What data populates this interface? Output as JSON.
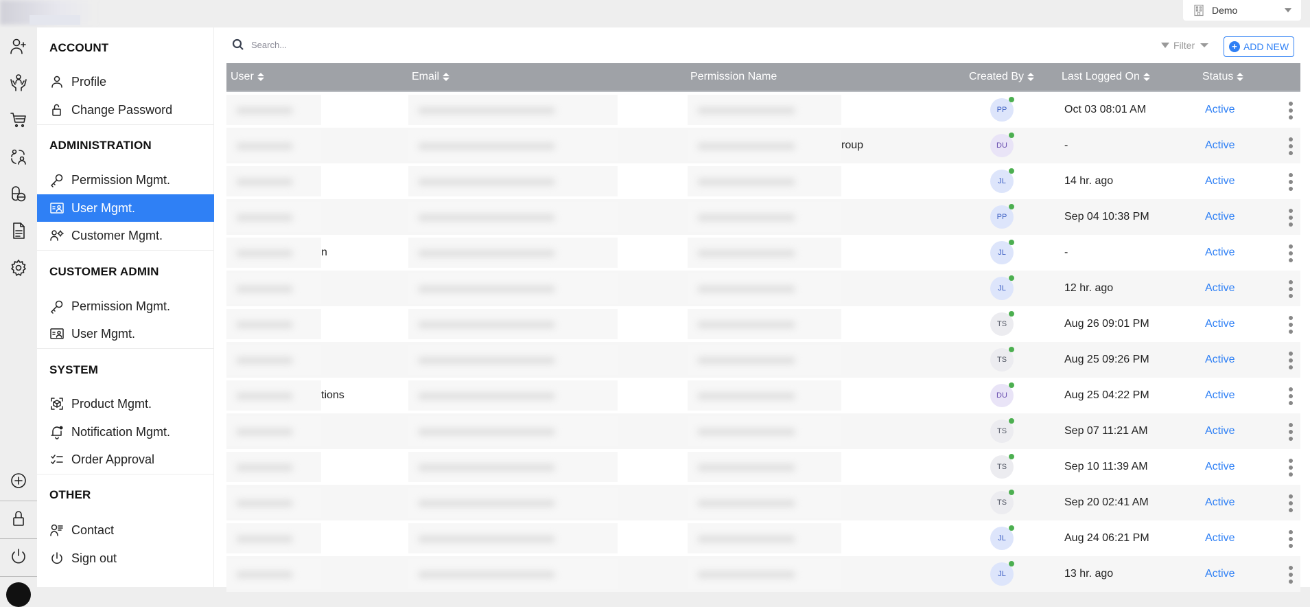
{
  "topbar": {
    "tenant": {
      "icon": "building-icon",
      "label": "Demo"
    }
  },
  "rail": {
    "items": [
      {
        "icon": "user-plus-icon"
      },
      {
        "icon": "hands-user-icon"
      },
      {
        "icon": "cart-icon"
      },
      {
        "icon": "users-swap-icon"
      },
      {
        "icon": "pill-icon"
      },
      {
        "icon": "document-icon"
      },
      {
        "icon": "gear-icon"
      }
    ],
    "bottom": [
      {
        "icon": "plus-circle-icon"
      },
      {
        "icon": "lock-icon"
      },
      {
        "icon": "power-icon"
      }
    ]
  },
  "menu": {
    "sections": [
      {
        "title": "ACCOUNT",
        "items": [
          {
            "label": "Profile",
            "icon": "user-icon"
          },
          {
            "label": "Change Password",
            "icon": "unlock-icon"
          }
        ]
      },
      {
        "title": "ADMINISTRATION",
        "items": [
          {
            "label": "Permission Mgmt.",
            "icon": "key-icon"
          },
          {
            "label": "User Mgmt.",
            "icon": "id-card-icon",
            "active": true
          },
          {
            "label": "Customer Mgmt.",
            "icon": "user-gear-icon"
          }
        ]
      },
      {
        "title": "CUSTOMER ADMIN",
        "items": [
          {
            "label": "Permission Mgmt.",
            "icon": "key-icon"
          },
          {
            "label": "User Mgmt.",
            "icon": "id-card-icon"
          }
        ]
      },
      {
        "title": "SYSTEM",
        "items": [
          {
            "label": "Product Mgmt.",
            "icon": "box-scan-icon"
          },
          {
            "label": "Notification Mgmt.",
            "icon": "bell-icon"
          },
          {
            "label": "Order Approval",
            "icon": "checklist-icon"
          }
        ]
      },
      {
        "title": "OTHER",
        "items": [
          {
            "label": "Contact",
            "icon": "contact-icon"
          },
          {
            "label": "Sign out",
            "icon": "power-icon"
          }
        ]
      }
    ]
  },
  "toolbar": {
    "search_placeholder": "Search...",
    "filter_label": "Filter",
    "add_new_label": "ADD NEW"
  },
  "table": {
    "columns": [
      "User",
      "Email",
      "Permission Name",
      "Created By",
      "Last Logged On",
      "Status"
    ],
    "rows": [
      {
        "user_fragment": "",
        "perm_fragment": "",
        "created_by": "PP",
        "last_logged": "Oct 03 08:01 AM",
        "status": "Active"
      },
      {
        "user_fragment": "",
        "perm_fragment": "roup",
        "created_by": "DU",
        "last_logged": "-",
        "status": "Active"
      },
      {
        "user_fragment": "",
        "perm_fragment": "",
        "created_by": "JL",
        "last_logged": "14 hr. ago",
        "status": "Active"
      },
      {
        "user_fragment": "",
        "perm_fragment": "",
        "created_by": "PP",
        "last_logged": "Sep 04 10:38 PM",
        "status": "Active"
      },
      {
        "user_fragment": "n",
        "perm_fragment": "",
        "created_by": "JL",
        "last_logged": "-",
        "status": "Active"
      },
      {
        "user_fragment": "",
        "perm_fragment": "",
        "created_by": "JL",
        "last_logged": "12 hr. ago",
        "status": "Active"
      },
      {
        "user_fragment": "",
        "perm_fragment": "",
        "created_by": "TS",
        "last_logged": "Aug 26 09:01 PM",
        "status": "Active"
      },
      {
        "user_fragment": "",
        "perm_fragment": "",
        "created_by": "TS",
        "last_logged": "Aug 25 09:26 PM",
        "status": "Active"
      },
      {
        "user_fragment": "tions",
        "perm_fragment": "",
        "created_by": "DU",
        "last_logged": "Aug 25 04:22 PM",
        "status": "Active"
      },
      {
        "user_fragment": "",
        "perm_fragment": "",
        "created_by": "TS",
        "last_logged": "Sep 07 11:21 AM",
        "status": "Active"
      },
      {
        "user_fragment": "",
        "perm_fragment": "",
        "created_by": "TS",
        "last_logged": "Sep 10 11:39 AM",
        "status": "Active"
      },
      {
        "user_fragment": "",
        "perm_fragment": "",
        "created_by": "TS",
        "last_logged": "Sep 20 02:41 AM",
        "status": "Active"
      },
      {
        "user_fragment": "",
        "perm_fragment": "",
        "created_by": "JL",
        "last_logged": "Aug 24 06:21 PM",
        "status": "Active"
      },
      {
        "user_fragment": "",
        "perm_fragment": "",
        "created_by": "JL",
        "last_logged": "13 hr. ago",
        "status": "Active"
      }
    ]
  },
  "colors": {
    "accent": "#2f80f5",
    "header_bg": "#9fa2a7",
    "online_dot": "#4caf50",
    "avatar_PP": "#dde5fb",
    "avatar_JL": "#dde5fb",
    "avatar_DU": "#e9e4f7",
    "avatar_TS": "#ececf0"
  }
}
